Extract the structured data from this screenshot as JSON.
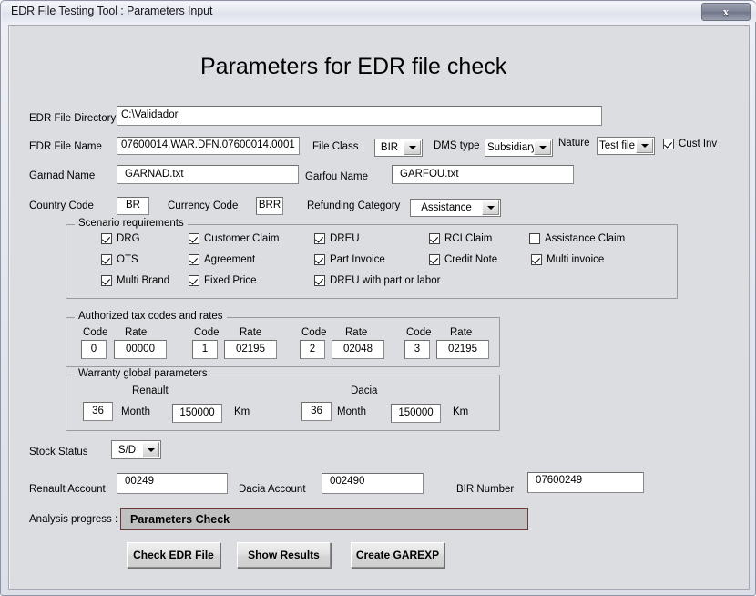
{
  "window": {
    "title": "EDR File Testing Tool : Parameters Input",
    "close_label": "x"
  },
  "heading": "Parameters for EDR file check",
  "fields": {
    "edr_file_directory": {
      "label": "EDR File Directory",
      "value": "C:\\Validador"
    },
    "edr_file_name": {
      "label": "EDR File Name",
      "value": "07600014.WAR.DFN.07600014.0001"
    },
    "file_class": {
      "label": "File Class",
      "value": "BIR"
    },
    "dms_type": {
      "label": "DMS type",
      "value": "Subsidiary"
    },
    "nature": {
      "label": "Nature",
      "value": "Test file"
    },
    "cust_inv": {
      "label": "Cust Inv",
      "checked": true
    },
    "garnad_name": {
      "label": "Garnad Name",
      "value": "GARNAD.txt"
    },
    "garfou_name": {
      "label": "Garfou Name",
      "value": "GARFOU.txt"
    },
    "country_code": {
      "label": "Country Code",
      "value": "BR"
    },
    "currency_code": {
      "label": "Currency Code",
      "value": "BRR"
    },
    "refunding_category": {
      "label": "Refunding Category",
      "value": "Assistance"
    },
    "stock_status": {
      "label": "Stock Status",
      "value": "S/D"
    },
    "renault_account": {
      "label": "Renault Account",
      "value": "00249"
    },
    "dacia_account": {
      "label": "Dacia Account",
      "value": "002490"
    },
    "bir_number": {
      "label": "BIR Number",
      "value": "07600249"
    }
  },
  "scenario": {
    "title": "Scenario requirements",
    "checkboxes": [
      {
        "label": "DRG",
        "checked": true
      },
      {
        "label": "Customer Claim",
        "checked": true
      },
      {
        "label": "DREU",
        "checked": true
      },
      {
        "label": "RCI Claim",
        "checked": true
      },
      {
        "label": "Assistance Claim",
        "checked": false
      },
      {
        "label": "OTS",
        "checked": true
      },
      {
        "label": "Agreement",
        "checked": true
      },
      {
        "label": "Part Invoice",
        "checked": true
      },
      {
        "label": "Credit Note",
        "checked": true
      },
      {
        "label": "Multi invoice",
        "checked": true
      },
      {
        "label": "Multi Brand",
        "checked": true
      },
      {
        "label": "Fixed Price",
        "checked": true
      },
      {
        "label": "DREU with part or labor",
        "checked": true
      }
    ]
  },
  "tax": {
    "title": "Authorized tax codes and rates",
    "code_label": "Code",
    "rate_label": "Rate",
    "rows": [
      {
        "code": "0",
        "rate": "00000"
      },
      {
        "code": "1",
        "rate": "02195"
      },
      {
        "code": "2",
        "rate": "02048"
      },
      {
        "code": "3",
        "rate": "02195"
      }
    ]
  },
  "warranty": {
    "title": "Warranty global parameters",
    "month_label": "Month",
    "km_label": "Km",
    "brands": [
      {
        "name": "Renault",
        "month": "36",
        "km": "150000"
      },
      {
        "name": "Dacia",
        "month": "36",
        "km": "150000"
      }
    ]
  },
  "analysis": {
    "label": "Analysis progress :",
    "status": "Parameters Check",
    "border_color": "#6b3a36",
    "fill_color": "#c0c0c0"
  },
  "buttons": [
    {
      "label": "Check EDR File"
    },
    {
      "label": "Show Results"
    },
    {
      "label": "Create GAREXP"
    }
  ]
}
